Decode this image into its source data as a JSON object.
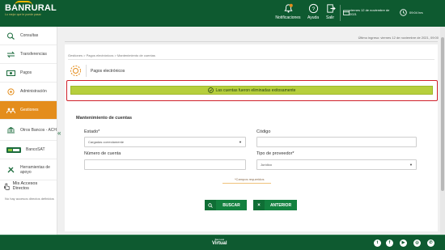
{
  "header": {
    "logo": "BANRURAL",
    "logo_tagline": "Lo mejor que te puede pasar",
    "notifications_label": "Notificaciones",
    "notifications_badge": "0",
    "help_label": "Ayuda",
    "logout_label": "Salir",
    "date_text": "viernes 12 de noviembre de 2021",
    "time_text": "09:04 hrs"
  },
  "sidebar": {
    "items": [
      {
        "label": "Consultas",
        "icon": "magnifier-icon"
      },
      {
        "label": "Transferencias",
        "icon": "transfer-icon"
      },
      {
        "label": "Pagos",
        "icon": "money-icon"
      },
      {
        "label": "Administración",
        "icon": "coin-icon"
      },
      {
        "label": "Gestiones",
        "icon": "people-icon"
      },
      {
        "label": "Otros Bancos - ACH",
        "icon": "bank-icon"
      },
      {
        "label": "BancoSAT",
        "icon": "bancosat-logo"
      },
      {
        "label": "Herramientas de apoyo",
        "icon": "tools-icon"
      }
    ],
    "active_index": 4,
    "access_title": "Mis Accesos Directos",
    "no_access_text": "No hay accesos directos definidos"
  },
  "main": {
    "last_login": "Último ingreso: viernes 12 de noviembre de 2021, 09:00",
    "breadcrumb": "Gestiones > Pagos electrónicos > Mantenimiento de cuentas",
    "page_title": "Pagos electrónicos",
    "alert_text": "Las cuentas fueron eliminadas exitosamente",
    "section_title": "Mantenimiento de cuentas",
    "fields": {
      "estado_label": "Estado*",
      "estado_value": "Cargadas correctamente",
      "codigo_label": "Código",
      "codigo_value": "",
      "numero_label": "Número de cuenta",
      "numero_value": "",
      "tipo_label": "Tipo de proveedor*",
      "tipo_value": "Jurídico"
    },
    "required_note": "*Campos requeridos",
    "buttons": {
      "search": "BUSCAR",
      "back": "ANTERIOR"
    }
  },
  "footer": {
    "logo_main": "Virtual",
    "logo_small": "Banrural",
    "socials": [
      "twitter",
      "facebook",
      "youtube",
      "instagram",
      "whatsapp"
    ]
  },
  "colors": {
    "brand_green": "#0e5a30",
    "button_green": "#13813f",
    "active_orange": "#e48d1c",
    "alert_green": "#b6cf3d",
    "alert_outline": "#d0202a"
  }
}
